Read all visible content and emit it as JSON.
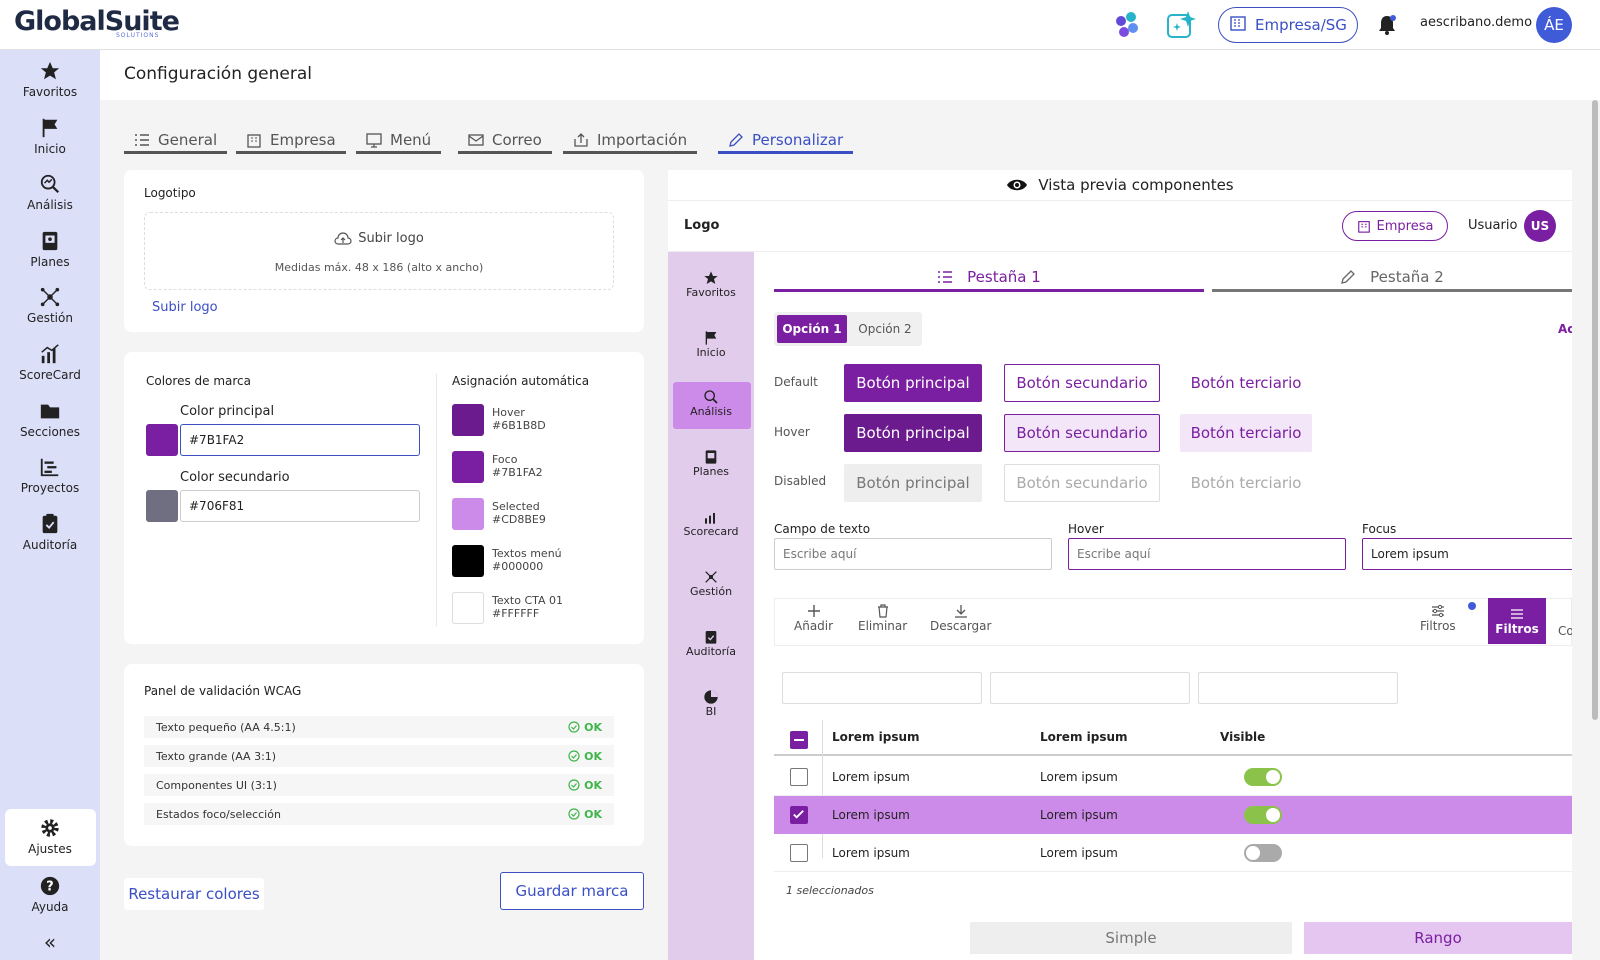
{
  "app": {
    "logo": "GlobalSuite",
    "logo_sub": "SOLUTIONS",
    "company": "Empresa/SG",
    "user": "aescribano.demo",
    "avatar": "ÁE"
  },
  "sidebar": {
    "items": [
      {
        "label": "Favoritos",
        "icon": "star-icon"
      },
      {
        "label": "Inicio",
        "icon": "flag-icon"
      },
      {
        "label": "Análisis",
        "icon": "analysis-icon"
      },
      {
        "label": "Planes",
        "icon": "plans-icon"
      },
      {
        "label": "Gestión",
        "icon": "network-icon"
      },
      {
        "label": "ScoreCard",
        "icon": "chart-icon"
      },
      {
        "label": "Secciones",
        "icon": "folder-icon"
      },
      {
        "label": "Proyectos",
        "icon": "projects-icon"
      },
      {
        "label": "Auditoría",
        "icon": "clipboard-icon"
      }
    ],
    "settings": "Ajustes",
    "help": "Ayuda",
    "collapse": "«"
  },
  "page": {
    "title": "Configuración general"
  },
  "tabs": [
    "General",
    "Empresa",
    "Menú",
    "Correo",
    "Importación",
    "Personalizar"
  ],
  "logo_card": {
    "title": "Logotipo",
    "upload": "Subir logo",
    "hint": "Medidas máx. 48 x 186 (alto x ancho)",
    "link": "Subir logo"
  },
  "brand": {
    "title": "Colores de marca",
    "primary_label": "Color principal",
    "primary_value": "#7B1FA2",
    "secondary_label": "Color secundario",
    "secondary_value": "#706F81",
    "auto_title": "Asignación automática",
    "auto": [
      {
        "name": "Hover",
        "hex": "#6B1B8D"
      },
      {
        "name": "Foco",
        "hex": "#7B1FA2"
      },
      {
        "name": "Selected",
        "hex": "#CD8BE9"
      },
      {
        "name": "Textos menú",
        "hex": "#000000"
      },
      {
        "name": "Texto CTA 01",
        "hex": "#FFFFFF"
      }
    ]
  },
  "wcag": {
    "title": "Panel de validación WCAG",
    "rows": [
      {
        "label": "Texto pequeño (AA 4.5:1)",
        "status": "OK"
      },
      {
        "label": "Texto grande (AA 3:1)",
        "status": "OK"
      },
      {
        "label": "Componentes UI (3:1)",
        "status": "OK"
      },
      {
        "label": "Estados foco/selección",
        "status": "OK"
      }
    ]
  },
  "actions": {
    "restore": "Restaurar colores",
    "save": "Guardar marca"
  },
  "preview": {
    "title": "Vista previa componentes",
    "logo": "Logo",
    "company": "Empresa",
    "user": "Usuario",
    "avatar": "US",
    "side": [
      "Favoritos",
      "Inicio",
      "Análisis",
      "Planes",
      "Scorecard",
      "Gestión",
      "Auditoría",
      "BI"
    ],
    "tabs": [
      "Pestaña 1",
      "Pestaña 2"
    ],
    "options": [
      "Opción 1",
      "Opción 2"
    ],
    "options_extra": "Ac",
    "states": [
      "Default",
      "Hover",
      "Disabled"
    ],
    "buttons": [
      "Botón principal",
      "Botón secundario",
      "Botón terciario"
    ],
    "fields": {
      "labels": [
        "Campo de texto",
        "Hover",
        "Focus"
      ],
      "placeholder": "Escribe aquí",
      "focus_value": "Lorem ipsum"
    },
    "toolbar": [
      "Añadir",
      "Eliminar",
      "Descargar"
    ],
    "filters": "Filtros",
    "filters_active": "Filtros",
    "cols_cut": "Co",
    "table": {
      "headers": [
        "Lorem ipsum",
        "Lorem ipsum",
        "Visible"
      ],
      "rows": [
        {
          "c1": "Lorem ipsum",
          "c2": "Lorem ipsum",
          "checked": false,
          "visible": true
        },
        {
          "c1": "Lorem ipsum",
          "c2": "Lorem ipsum",
          "checked": true,
          "visible": true
        },
        {
          "c1": "Lorem ipsum",
          "c2": "Lorem ipsum",
          "checked": false,
          "visible": false
        }
      ],
      "footer": "1 seleccionados"
    },
    "bottom": [
      "Simple",
      "Rango"
    ]
  },
  "colors": {
    "brand": "#7B1FA2",
    "hover": "#6B1B8D",
    "selected": "#CD8BE9",
    "secondary": "#706F81",
    "accent": "#3A4FC4",
    "ok": "#3FB54A",
    "toggle_on": "#8BC34A"
  }
}
